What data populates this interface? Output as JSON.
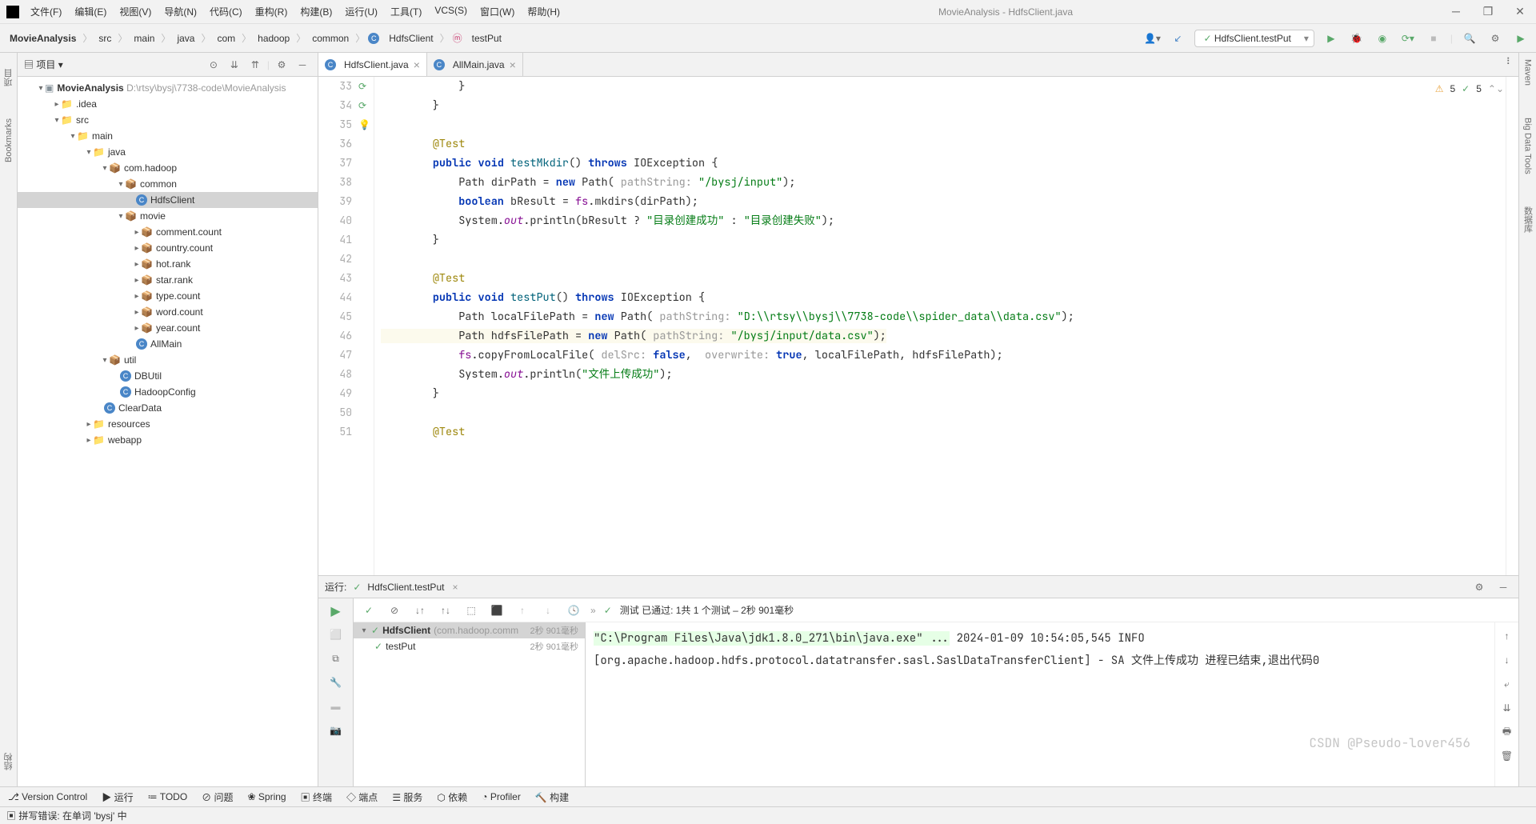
{
  "window": {
    "title": "MovieAnalysis - HdfsClient.java"
  },
  "menu": [
    "文件(F)",
    "编辑(E)",
    "视图(V)",
    "导航(N)",
    "代码(C)",
    "重构(R)",
    "构建(B)",
    "运行(U)",
    "工具(T)",
    "VCS(S)",
    "窗口(W)",
    "帮助(H)"
  ],
  "breadcrumb": [
    "MovieAnalysis",
    "src",
    "main",
    "java",
    "com",
    "hadoop",
    "common",
    "HdfsClient",
    "testPut"
  ],
  "run_config": "HdfsClient.testPut",
  "project_label": "项目",
  "tree": {
    "root": "MovieAnalysis",
    "root_path": "D:\\rtsy\\bysj\\7738-code\\MovieAnalysis",
    "idea": ".idea",
    "src": "src",
    "main": "main",
    "java": "java",
    "pkg": "com.hadoop",
    "common": "common",
    "hdfs": "HdfsClient",
    "movie": "movie",
    "mc": "comment.count",
    "cc": "country.count",
    "hr": "hot.rank",
    "sr": "star.rank",
    "tc": "type.count",
    "wc": "word.count",
    "yc": "year.count",
    "allmain": "AllMain",
    "util": "util",
    "dbutil": "DBUtil",
    "hadoopcfg": "HadoopConfig",
    "cleardata": "ClearData",
    "resources": "resources",
    "webapp": "webapp"
  },
  "tabs": {
    "active": "HdfsClient.java",
    "other": "AllMain.java"
  },
  "inspections": {
    "warn": "5",
    "ok": "5"
  },
  "gutter": [
    "33",
    "34",
    "35",
    "36",
    "37",
    "38",
    "39",
    "40",
    "41",
    "42",
    "43",
    "44",
    "45",
    "46",
    "47",
    "48",
    "49",
    "50",
    "51"
  ],
  "code": {
    "ann": "@Test",
    "pub": "public",
    "void": "void",
    "throws": "throws",
    "ioe": "IOException",
    "new": "new",
    "boolean": "boolean",
    "true": "true",
    "false": "false",
    "mkdir": "testMkdir",
    "put": "testPut",
    "path": "Path",
    "system": "System",
    "out": "out",
    "println": "println",
    "pathHint": "pathString:",
    "delSrcHint": "delSrc:",
    "overwriteHint": "overwrite:",
    "mkdirStr": "\"/bysj/input\"",
    "okStr": "\"目录创建成功\"",
    "failStr": "\"目录创建失败\"",
    "localStr": "\"D:\\\\rtsy\\\\bysj\\\\7738-code\\\\spider_data\\\\data.csv\"",
    "hdfsStr": "\"/bysj/input/data.csv\"",
    "uploadOk": "\"文件上传成功\"",
    "fs": "fs",
    "mkdirs": "mkdirs",
    "copy": "copyFromLocalFile",
    "dirPath": "dirPath",
    "bResult": "bResult",
    "localFilePath": "localFilePath",
    "hdfsFilePath": "hdfsFilePath"
  },
  "run": {
    "header_label": "运行:",
    "header_name": "HdfsClient.testPut",
    "toolbar_text": "测试 已通过: 1共 1 个测试 – 2秒 901毫秒",
    "test_class": "HdfsClient",
    "test_pkg": "(com.hadoop.comm",
    "test_time1": "2秒 901毫秒",
    "test_method": "testPut",
    "test_time2": "2秒 901毫秒",
    "console1": "\"C:\\Program Files\\Java\\jdk1.8.0_271\\bin\\java.exe\" ...",
    "console2": "2024-01-09 10:54:05,545 INFO [org.apache.hadoop.hdfs.protocol.datatransfer.sasl.SaslDataTransferClient] - SA",
    "console3": "文件上传成功",
    "console4": "进程已结束,退出代码0"
  },
  "bottom": {
    "vc": "Version Control",
    "run": "运行",
    "todo": "TODO",
    "problems": "问题",
    "spring": "Spring",
    "terminal": "终端",
    "breakpoints": "端点",
    "services": "服务",
    "deps": "依赖",
    "profiler": "Profiler",
    "build": "构建"
  },
  "status": "拼写错误: 在单词 'bysj' 中",
  "watermark": "CSDN @Pseudo-lover456",
  "sidebar": {
    "project": "项目",
    "bookmarks": "Bookmarks",
    "structure": "结构",
    "maven": "Maven",
    "bigdata": "Big Data Tools",
    "db": "数据库"
  }
}
